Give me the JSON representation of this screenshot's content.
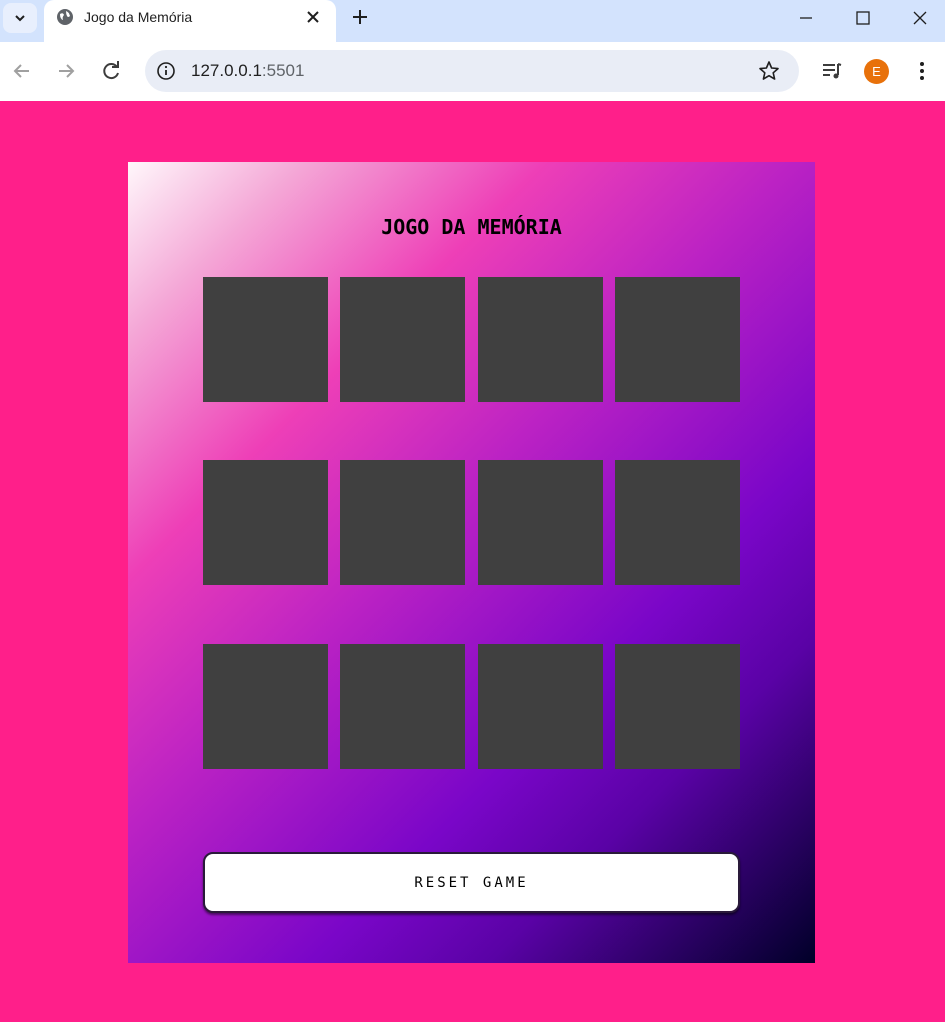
{
  "browser": {
    "tab": {
      "title": "Jogo da Memória",
      "favicon": "globe-icon"
    },
    "address_bar": {
      "host": "127.0.0.1",
      "port": ":5501"
    },
    "profile_initial": "E",
    "icons": [
      "tab-list-chevron-icon",
      "globe-icon",
      "close-icon",
      "plus-icon",
      "minimize-icon",
      "maximize-icon",
      "window-close-icon",
      "back-arrow-icon",
      "forward-arrow-icon",
      "reload-icon",
      "site-info-icon",
      "star-icon",
      "media-control-icon",
      "kebab-menu-icon"
    ]
  },
  "page": {
    "title": "JOGO DA MEMÓRIA",
    "cards": [
      {
        "state": "face-down"
      },
      {
        "state": "face-down"
      },
      {
        "state": "face-down"
      },
      {
        "state": "face-down"
      },
      {
        "state": "face-down"
      },
      {
        "state": "face-down"
      },
      {
        "state": "face-down"
      },
      {
        "state": "face-down"
      },
      {
        "state": "face-down"
      },
      {
        "state": "face-down"
      },
      {
        "state": "face-down"
      },
      {
        "state": "face-down"
      }
    ],
    "reset_label": "RESET GAME"
  },
  "colors": {
    "page_background": "#ff1f8a",
    "card_back": "#404040",
    "gradient": [
      "#fff7fb",
      "#ee3fb7",
      "#7a06c8",
      "#000028"
    ],
    "avatar": "#e8710a"
  }
}
